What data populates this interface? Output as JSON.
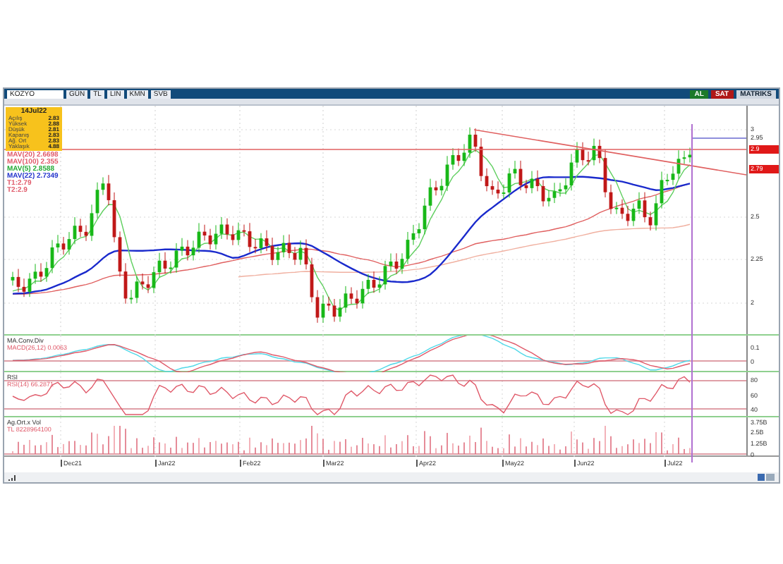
{
  "window": {
    "symbol": "KOZYO",
    "toolbar": [
      "GÜN",
      "TL",
      "LIN",
      "KMN",
      "SVB"
    ],
    "trade_buttons": [
      {
        "label": "AL",
        "kind": "buy"
      },
      {
        "label": "SAT",
        "kind": "sell"
      }
    ],
    "brand": "MATRIKS"
  },
  "info_box": {
    "date": "14Jul22",
    "rows": [
      {
        "label": "Açılış",
        "value": "2.83"
      },
      {
        "label": "Yüksek",
        "value": "2.88"
      },
      {
        "label": "Düşük",
        "value": "2.81"
      },
      {
        "label": "Kapanış",
        "value": "2.83"
      },
      {
        "label": "Ağ. Ort",
        "value": "2.83"
      },
      {
        "label": "Yaklaşık",
        "value": "4.88"
      }
    ]
  },
  "legend": [
    {
      "text": "MAV(20)  2.6698",
      "color": "#e05a6a"
    },
    {
      "text": "MAV(100)  2.355",
      "color": "#e05a6a"
    },
    {
      "text": "MAV(5)  2.8588",
      "color": "#22aa33"
    },
    {
      "text": "MAV(22)  2.7349",
      "color": "#2233cc"
    },
    {
      "text": "T1:2.79",
      "color": "#e05a6a"
    },
    {
      "text": "T2:2.9",
      "color": "#e05a6a"
    }
  ],
  "price_axis": [
    {
      "label": "3",
      "kind": "tick"
    },
    {
      "label": "2.95",
      "kind": "tick"
    },
    {
      "label": "2.9",
      "kind": "marker"
    },
    {
      "label": "2.79",
      "kind": "marker"
    },
    {
      "label": "2.5",
      "kind": "tick"
    },
    {
      "label": "2.25",
      "kind": "tick"
    },
    {
      "label": "2",
      "kind": "tick"
    }
  ],
  "macd": {
    "title": "MA.Conv.Div",
    "reading": "MACD(26,12)  0.0063",
    "axis": [
      "0.1",
      "0"
    ]
  },
  "rsi": {
    "title": "RSI",
    "reading": "RSI(14)  66.2871",
    "axis": [
      "80",
      "60",
      "40"
    ]
  },
  "volume": {
    "title": "Ag.Ort.x Vol",
    "reading": "TL  8228964100",
    "axis": [
      "3.75B",
      "2.5B",
      "1.25B",
      "0"
    ]
  },
  "x_axis": [
    "Dec21",
    "Jan22",
    "Feb22",
    "Mar22",
    "Apr22",
    "May22",
    "Jun22",
    "Jul22"
  ]
}
